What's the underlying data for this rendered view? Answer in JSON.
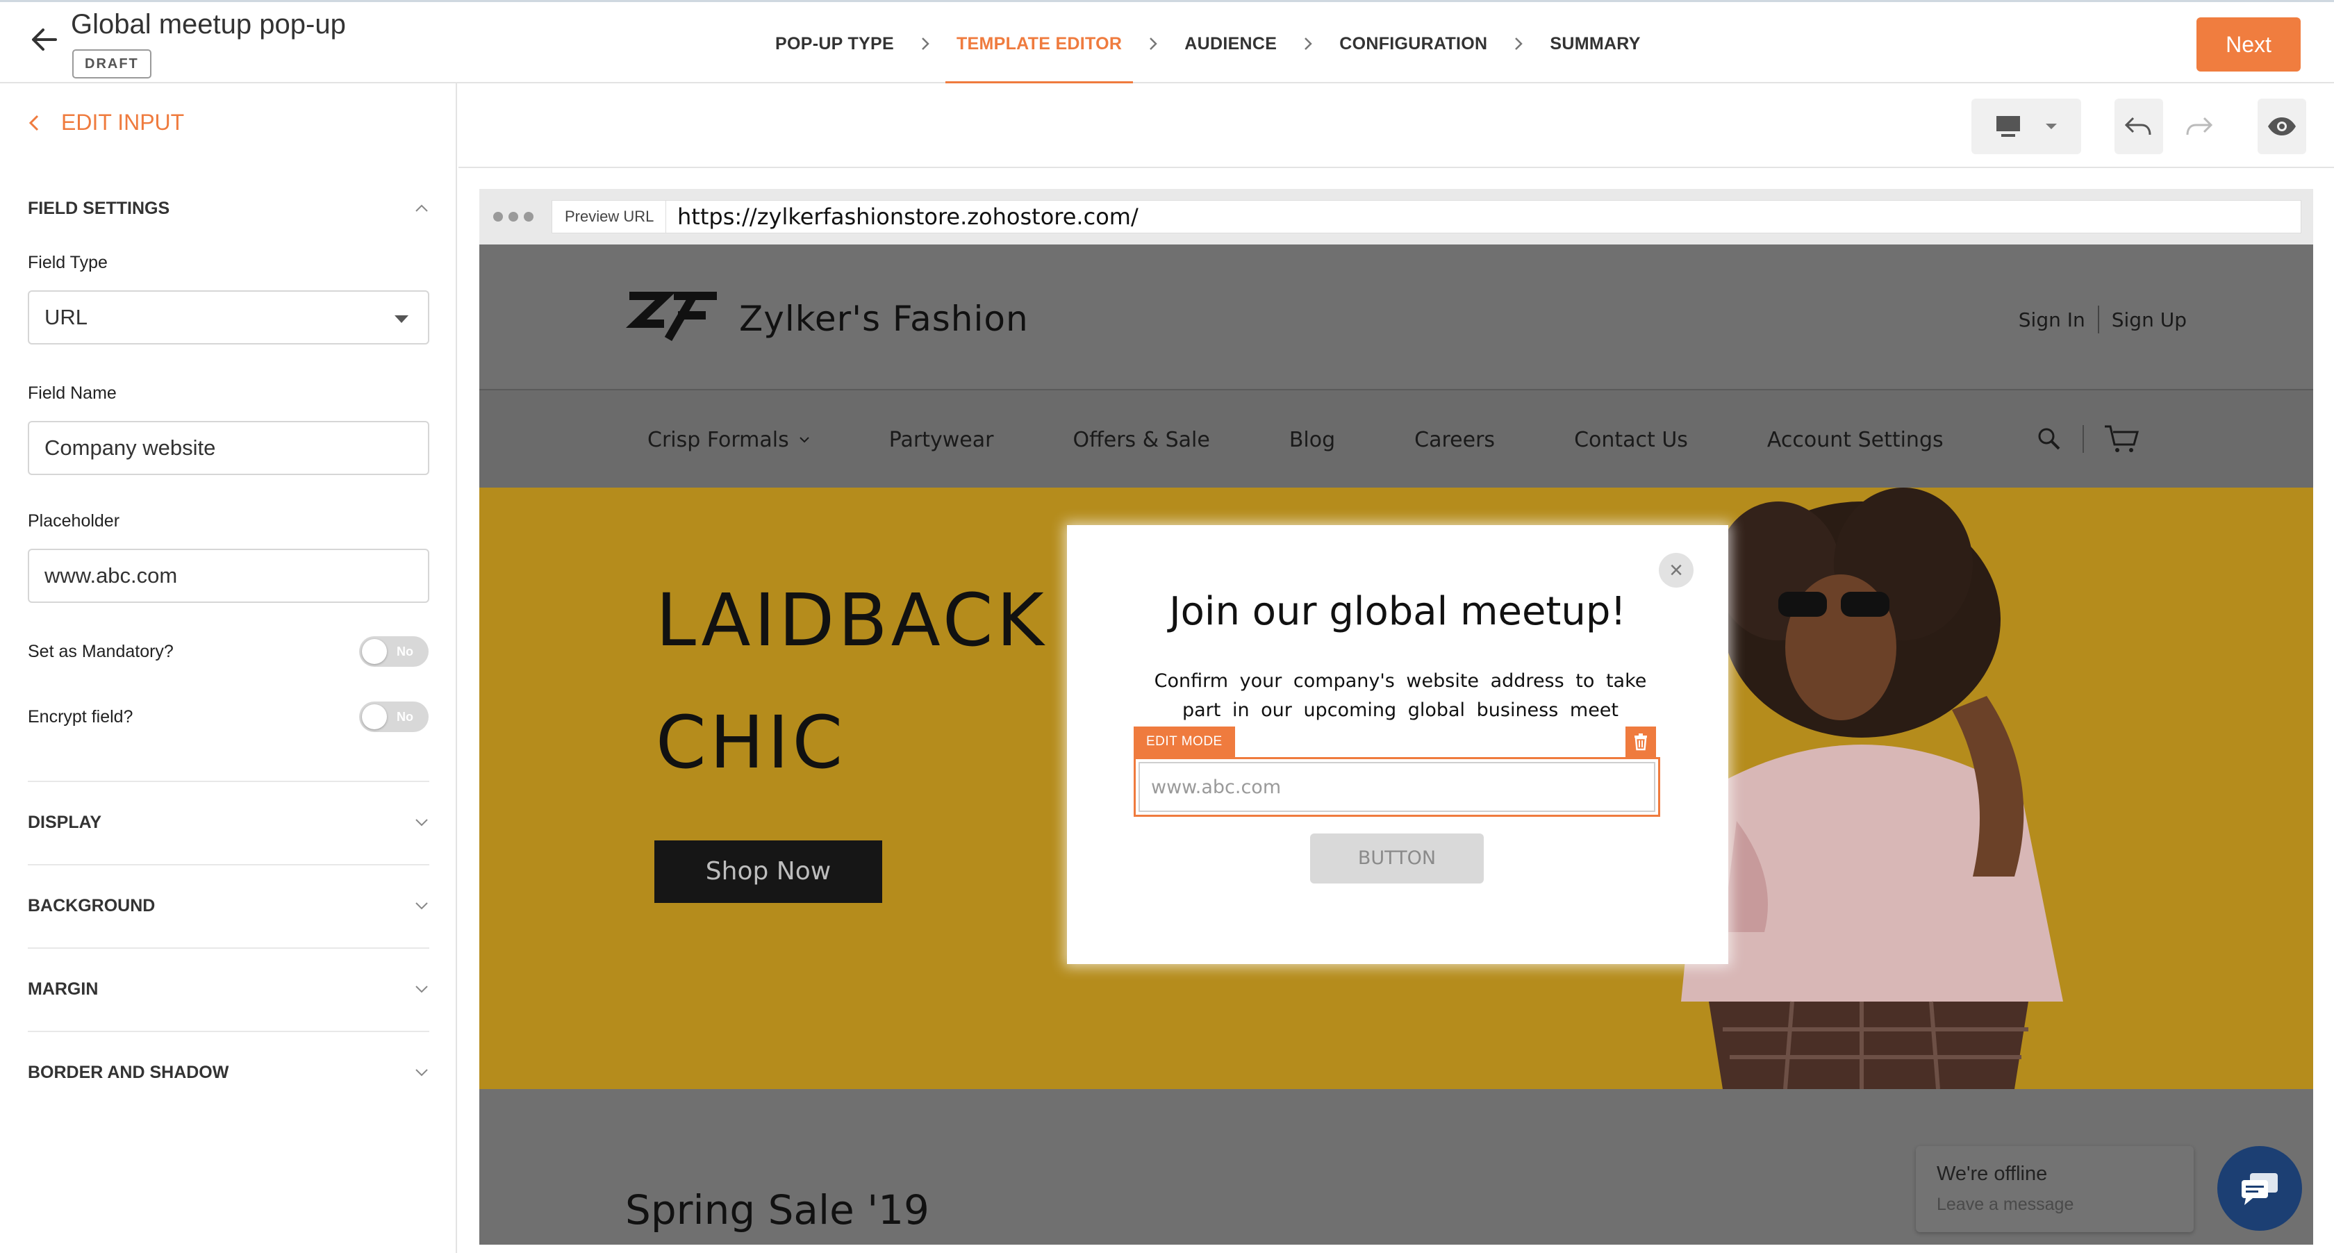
{
  "header": {
    "title": "Global meetup pop-up",
    "status_badge": "DRAFT",
    "steps": [
      {
        "label": "POP-UP TYPE",
        "active": false
      },
      {
        "label": "TEMPLATE EDITOR",
        "active": true
      },
      {
        "label": "AUDIENCE",
        "active": false
      },
      {
        "label": "CONFIGURATION",
        "active": false
      },
      {
        "label": "SUMMARY",
        "active": false
      }
    ],
    "next_label": "Next",
    "accent_color": "#ef7b3e"
  },
  "sidebar": {
    "back_label": "EDIT INPUT",
    "field_settings_label": "FIELD SETTINGS",
    "field_type_label": "Field Type",
    "field_type_value": "URL",
    "field_name_label": "Field Name",
    "field_name_value": "Company website",
    "placeholder_label": "Placeholder",
    "placeholder_value": "www.abc.com",
    "mandatory_label": "Set as Mandatory?",
    "mandatory_toggle": "No",
    "encrypt_label": "Encrypt field?",
    "encrypt_toggle": "No",
    "sections": [
      "DISPLAY",
      "BACKGROUND",
      "MARGIN",
      "BORDER AND SHADOW"
    ]
  },
  "toolbar": {
    "device": "desktop-icon",
    "icons": [
      "chevron-down-icon",
      "undo-icon",
      "redo-icon",
      "eye-icon"
    ]
  },
  "preview": {
    "url_label": "Preview URL",
    "url": "https://zylkerfashionstore.zohostore.com/",
    "site": {
      "brand": "Zylker's Fashion",
      "sign_in": "Sign In",
      "sign_up": "Sign Up",
      "nav": [
        "Crisp Formals",
        "Partywear",
        "Offers & Sale",
        "Blog",
        "Careers",
        "Contact Us",
        "Account Settings"
      ],
      "hero_line1": "LAIDBACK",
      "hero_line2": "CHIC",
      "hero_button": "Shop Now",
      "section_title": "Spring Sale '19",
      "chat_title": "We're offline",
      "chat_subtitle": "Leave a message"
    },
    "popup": {
      "heading": "Join our global meetup!",
      "description": "Confirm your company's website address to take part in our upcoming global business meet",
      "edit_mode_label": "EDIT MODE",
      "input_placeholder": "www.abc.com",
      "button_label": "BUTTON",
      "close_glyph": "×"
    }
  }
}
